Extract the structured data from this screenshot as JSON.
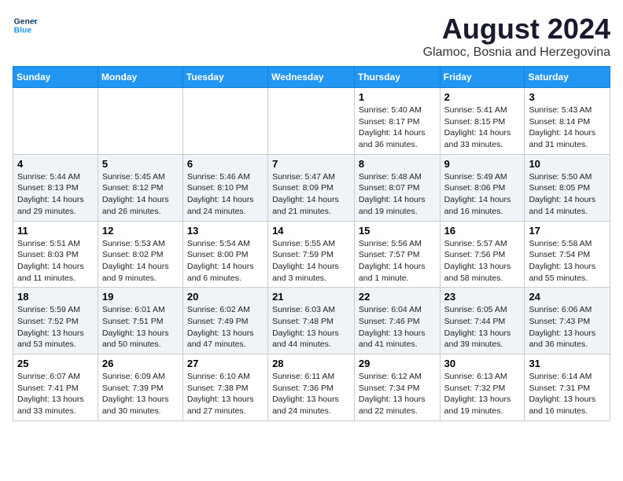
{
  "header": {
    "logo_line1": "General",
    "logo_line2": "Blue",
    "month_title": "August 2024",
    "location": "Glamoc, Bosnia and Herzegovina"
  },
  "weekdays": [
    "Sunday",
    "Monday",
    "Tuesday",
    "Wednesday",
    "Thursday",
    "Friday",
    "Saturday"
  ],
  "weeks": [
    [
      {
        "day": "",
        "info": ""
      },
      {
        "day": "",
        "info": ""
      },
      {
        "day": "",
        "info": ""
      },
      {
        "day": "",
        "info": ""
      },
      {
        "day": "1",
        "info": "Sunrise: 5:40 AM\nSunset: 8:17 PM\nDaylight: 14 hours\nand 36 minutes."
      },
      {
        "day": "2",
        "info": "Sunrise: 5:41 AM\nSunset: 8:15 PM\nDaylight: 14 hours\nand 33 minutes."
      },
      {
        "day": "3",
        "info": "Sunrise: 5:43 AM\nSunset: 8:14 PM\nDaylight: 14 hours\nand 31 minutes."
      }
    ],
    [
      {
        "day": "4",
        "info": "Sunrise: 5:44 AM\nSunset: 8:13 PM\nDaylight: 14 hours\nand 29 minutes."
      },
      {
        "day": "5",
        "info": "Sunrise: 5:45 AM\nSunset: 8:12 PM\nDaylight: 14 hours\nand 26 minutes."
      },
      {
        "day": "6",
        "info": "Sunrise: 5:46 AM\nSunset: 8:10 PM\nDaylight: 14 hours\nand 24 minutes."
      },
      {
        "day": "7",
        "info": "Sunrise: 5:47 AM\nSunset: 8:09 PM\nDaylight: 14 hours\nand 21 minutes."
      },
      {
        "day": "8",
        "info": "Sunrise: 5:48 AM\nSunset: 8:07 PM\nDaylight: 14 hours\nand 19 minutes."
      },
      {
        "day": "9",
        "info": "Sunrise: 5:49 AM\nSunset: 8:06 PM\nDaylight: 14 hours\nand 16 minutes."
      },
      {
        "day": "10",
        "info": "Sunrise: 5:50 AM\nSunset: 8:05 PM\nDaylight: 14 hours\nand 14 minutes."
      }
    ],
    [
      {
        "day": "11",
        "info": "Sunrise: 5:51 AM\nSunset: 8:03 PM\nDaylight: 14 hours\nand 11 minutes."
      },
      {
        "day": "12",
        "info": "Sunrise: 5:53 AM\nSunset: 8:02 PM\nDaylight: 14 hours\nand 9 minutes."
      },
      {
        "day": "13",
        "info": "Sunrise: 5:54 AM\nSunset: 8:00 PM\nDaylight: 14 hours\nand 6 minutes."
      },
      {
        "day": "14",
        "info": "Sunrise: 5:55 AM\nSunset: 7:59 PM\nDaylight: 14 hours\nand 3 minutes."
      },
      {
        "day": "15",
        "info": "Sunrise: 5:56 AM\nSunset: 7:57 PM\nDaylight: 14 hours\nand 1 minute."
      },
      {
        "day": "16",
        "info": "Sunrise: 5:57 AM\nSunset: 7:56 PM\nDaylight: 13 hours\nand 58 minutes."
      },
      {
        "day": "17",
        "info": "Sunrise: 5:58 AM\nSunset: 7:54 PM\nDaylight: 13 hours\nand 55 minutes."
      }
    ],
    [
      {
        "day": "18",
        "info": "Sunrise: 5:59 AM\nSunset: 7:52 PM\nDaylight: 13 hours\nand 53 minutes."
      },
      {
        "day": "19",
        "info": "Sunrise: 6:01 AM\nSunset: 7:51 PM\nDaylight: 13 hours\nand 50 minutes."
      },
      {
        "day": "20",
        "info": "Sunrise: 6:02 AM\nSunset: 7:49 PM\nDaylight: 13 hours\nand 47 minutes."
      },
      {
        "day": "21",
        "info": "Sunrise: 6:03 AM\nSunset: 7:48 PM\nDaylight: 13 hours\nand 44 minutes."
      },
      {
        "day": "22",
        "info": "Sunrise: 6:04 AM\nSunset: 7:46 PM\nDaylight: 13 hours\nand 41 minutes."
      },
      {
        "day": "23",
        "info": "Sunrise: 6:05 AM\nSunset: 7:44 PM\nDaylight: 13 hours\nand 39 minutes."
      },
      {
        "day": "24",
        "info": "Sunrise: 6:06 AM\nSunset: 7:43 PM\nDaylight: 13 hours\nand 36 minutes."
      }
    ],
    [
      {
        "day": "25",
        "info": "Sunrise: 6:07 AM\nSunset: 7:41 PM\nDaylight: 13 hours\nand 33 minutes."
      },
      {
        "day": "26",
        "info": "Sunrise: 6:09 AM\nSunset: 7:39 PM\nDaylight: 13 hours\nand 30 minutes."
      },
      {
        "day": "27",
        "info": "Sunrise: 6:10 AM\nSunset: 7:38 PM\nDaylight: 13 hours\nand 27 minutes."
      },
      {
        "day": "28",
        "info": "Sunrise: 6:11 AM\nSunset: 7:36 PM\nDaylight: 13 hours\nand 24 minutes."
      },
      {
        "day": "29",
        "info": "Sunrise: 6:12 AM\nSunset: 7:34 PM\nDaylight: 13 hours\nand 22 minutes."
      },
      {
        "day": "30",
        "info": "Sunrise: 6:13 AM\nSunset: 7:32 PM\nDaylight: 13 hours\nand 19 minutes."
      },
      {
        "day": "31",
        "info": "Sunrise: 6:14 AM\nSunset: 7:31 PM\nDaylight: 13 hours\nand 16 minutes."
      }
    ]
  ]
}
